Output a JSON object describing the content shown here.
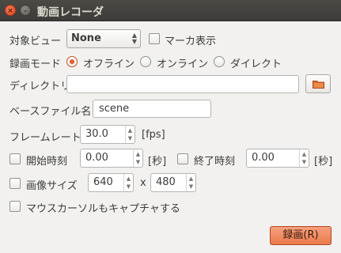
{
  "window": {
    "title": "動画レコーダ",
    "close_glyph": "×",
    "min_glyph": "–"
  },
  "target": {
    "label": "対象ビュー",
    "value": "None",
    "marker_label": "マーカ表示"
  },
  "mode": {
    "label": "録画モード",
    "options": [
      "オフライン",
      "オンライン",
      "ダイレクト"
    ],
    "selected": "オフライン"
  },
  "directory": {
    "label": "ディレクトリ",
    "value": "",
    "icon": "folder-icon"
  },
  "basefile": {
    "label": "ベースファイル名",
    "value": "scene"
  },
  "framerate": {
    "label": "フレームレート",
    "value": "30.0",
    "unit": "[fps]"
  },
  "start": {
    "label": "開始時刻",
    "value": "0.00",
    "unit": "[秒]"
  },
  "end": {
    "label": "終了時刻",
    "value": "0.00",
    "unit": "[秒]"
  },
  "imagesize": {
    "label": "画像サイズ",
    "width": "640",
    "sep": "x",
    "height": "480"
  },
  "capture_mouse": {
    "label": "マウスカーソルもキャプチャする"
  },
  "record_button": {
    "label": "録画(R)"
  },
  "colors": {
    "accent": "#e05e2c",
    "record_button": "#ef8a5d",
    "titlebar": "#3d3c38"
  }
}
